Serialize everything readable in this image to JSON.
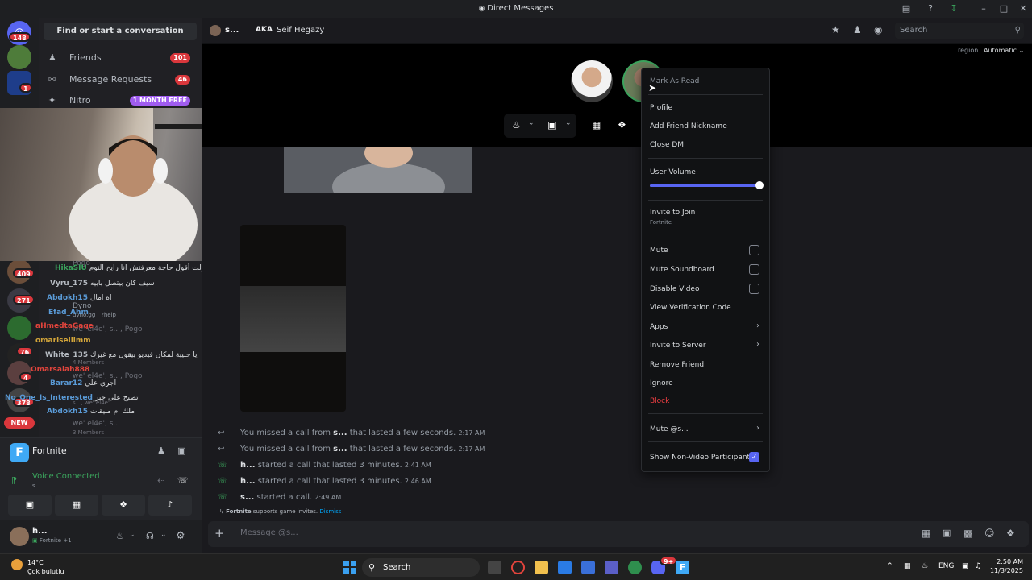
{
  "window": {
    "title": "Direct Messages"
  },
  "rail": {
    "home_badge": "148",
    "server_badges": [
      "1",
      "409",
      "271",
      "76",
      "4",
      "378"
    ],
    "new_label": "NEW"
  },
  "sidebar": {
    "find_button": "Find or start a conversation",
    "nav": [
      {
        "label": "Friends",
        "badge": "101"
      },
      {
        "label": "Message Requests",
        "badge": "46"
      },
      {
        "label": "Nitro",
        "badge": "1 MONTH FREE"
      }
    ],
    "overlay_chat": [
      {
        "name": "HikaSIU",
        "text": "حاولت أقول حاجة معرفتش انا رايح النوم",
        "color": "#3ba55d"
      },
      {
        "name": "Vyru_175",
        "text": "سيف كان بيتصل بابيه",
        "color": "#b5bac1"
      },
      {
        "name": "Abdokh15",
        "text": "اه امال",
        "color": "#5a9bd8"
      },
      {
        "name": "Efad_Ahm",
        "text": "",
        "color": "#5a9bd8"
      },
      {
        "name": "aHmedtaGage",
        "text": "",
        "color": "#e2443c"
      },
      {
        "name": "omarisellimm",
        "text": "",
        "color": "#d3a53a"
      },
      {
        "name": "White_135",
        "text": "يا حبيبة لمكان فيديو بيقول مع غيرك",
        "color": "#b5bac1"
      },
      {
        "name": "Omarsalah888",
        "text": "",
        "color": "#e2443c"
      },
      {
        "name": "Barar12",
        "text": "اجري علي",
        "color": "#5a9bd8"
      },
      {
        "name": "No_One_Is_Interested",
        "text": "تصبح على خير",
        "color": "#5a9bd8"
      },
      {
        "name": "Abdokh15",
        "text": "ملك ام منيقات",
        "color": "#5a9bd8"
      }
    ],
    "dm_rows": [
      {
        "name": "Pogo",
        "sub": ""
      },
      {
        "name": "Dyno",
        "sub": "dyno.gg | ?help"
      },
      {
        "name": "we' el4e', s..., Pogo",
        "sub": "4 Members"
      },
      {
        "name": "we' el4e', s..., Pogo",
        "sub": "4 Members"
      },
      {
        "name": "s..., we' el4e'",
        "sub": ""
      },
      {
        "name": "we' el4e', s...",
        "sub": "3 Members"
      }
    ]
  },
  "voice": {
    "game": "Fortnite",
    "status": "Voice Connected",
    "status_sub": "s...",
    "user_name": "h...",
    "user_activity": "Fortnite +1"
  },
  "header": {
    "user_short": "s...",
    "aka_label": "AKA",
    "aka_name": "Seif Hegazy",
    "search_placeholder": "Search",
    "region_label": "region",
    "region_value": "Automatic"
  },
  "messages": [
    {
      "pre": "You missed a call from ",
      "bold": "s...",
      "post": " that lasted a few seconds.",
      "time": "2:17 AM",
      "missed": true
    },
    {
      "pre": "You missed a call from ",
      "bold": "s...",
      "post": " that lasted a few seconds.",
      "time": "2:17 AM",
      "missed": true
    },
    {
      "pre": "",
      "bold": "h...",
      "post": " started a call that lasted 3 minutes.",
      "time": "2:41 AM",
      "missed": false
    },
    {
      "pre": "",
      "bold": "h...",
      "post": " started a call that lasted 3 minutes.",
      "time": "2:46 AM",
      "missed": false
    },
    {
      "pre": "",
      "bold": "s...",
      "post": " started a call.",
      "time": "2:49 AM",
      "missed": false
    }
  ],
  "invite_note": {
    "game": "Fortnite",
    "text": " supports game invites.",
    "dismiss": "Dismiss"
  },
  "composer": {
    "placeholder": "Message @s..."
  },
  "context_menu": {
    "mark_read": "Mark As Read",
    "profile": "Profile",
    "add_nickname": "Add Friend Nickname",
    "close_dm": "Close DM",
    "user_volume": "User Volume",
    "volume_value": 1.0,
    "invite_join": "Invite to Join",
    "invite_join_sub": "Fortnite",
    "mute": "Mute",
    "mute_soundboard": "Mute Soundboard",
    "disable_video": "Disable Video",
    "view_code": "View Verification Code",
    "apps": "Apps",
    "invite_server": "Invite to Server",
    "remove_friend": "Remove Friend",
    "ignore": "Ignore",
    "block": "Block",
    "mute_user": "Mute @s...",
    "show_non_video": "Show Non-Video Participants",
    "block_color": "#f23f43",
    "accent": "#5865f2"
  },
  "taskbar": {
    "weather_temp": "14°C",
    "weather_text": "Çok bulutlu",
    "search": "Search",
    "lang": "ENG",
    "time": "2:50 AM",
    "date": "11/3/2025",
    "discord_badge": "9+"
  }
}
